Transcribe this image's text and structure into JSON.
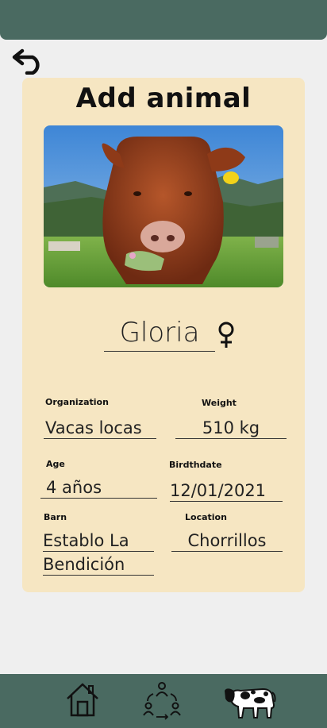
{
  "header": {
    "title": "Add animal"
  },
  "animal": {
    "name": "Gloria",
    "sex_symbol": "♀",
    "sex_icon": "female-icon"
  },
  "fields": {
    "organization": {
      "label": "Organization",
      "value": "Vacas locas"
    },
    "weight": {
      "label": "Weight",
      "value": "510 kg"
    },
    "age": {
      "label": "Age",
      "value": "4 años"
    },
    "birthdate": {
      "label": "Birdthdate",
      "value": "12/01/2021"
    },
    "barn": {
      "label": "Barn",
      "value_line1": "Establo La",
      "value_line2": "Bendición"
    },
    "location": {
      "label": "Location",
      "value": "Chorrillos"
    }
  },
  "nav": {
    "items": [
      "home-icon",
      "community-icon",
      "cow-icon"
    ]
  },
  "colors": {
    "bar": "#4a6a61",
    "card": "#f6e6c2",
    "background": "#efefef"
  }
}
